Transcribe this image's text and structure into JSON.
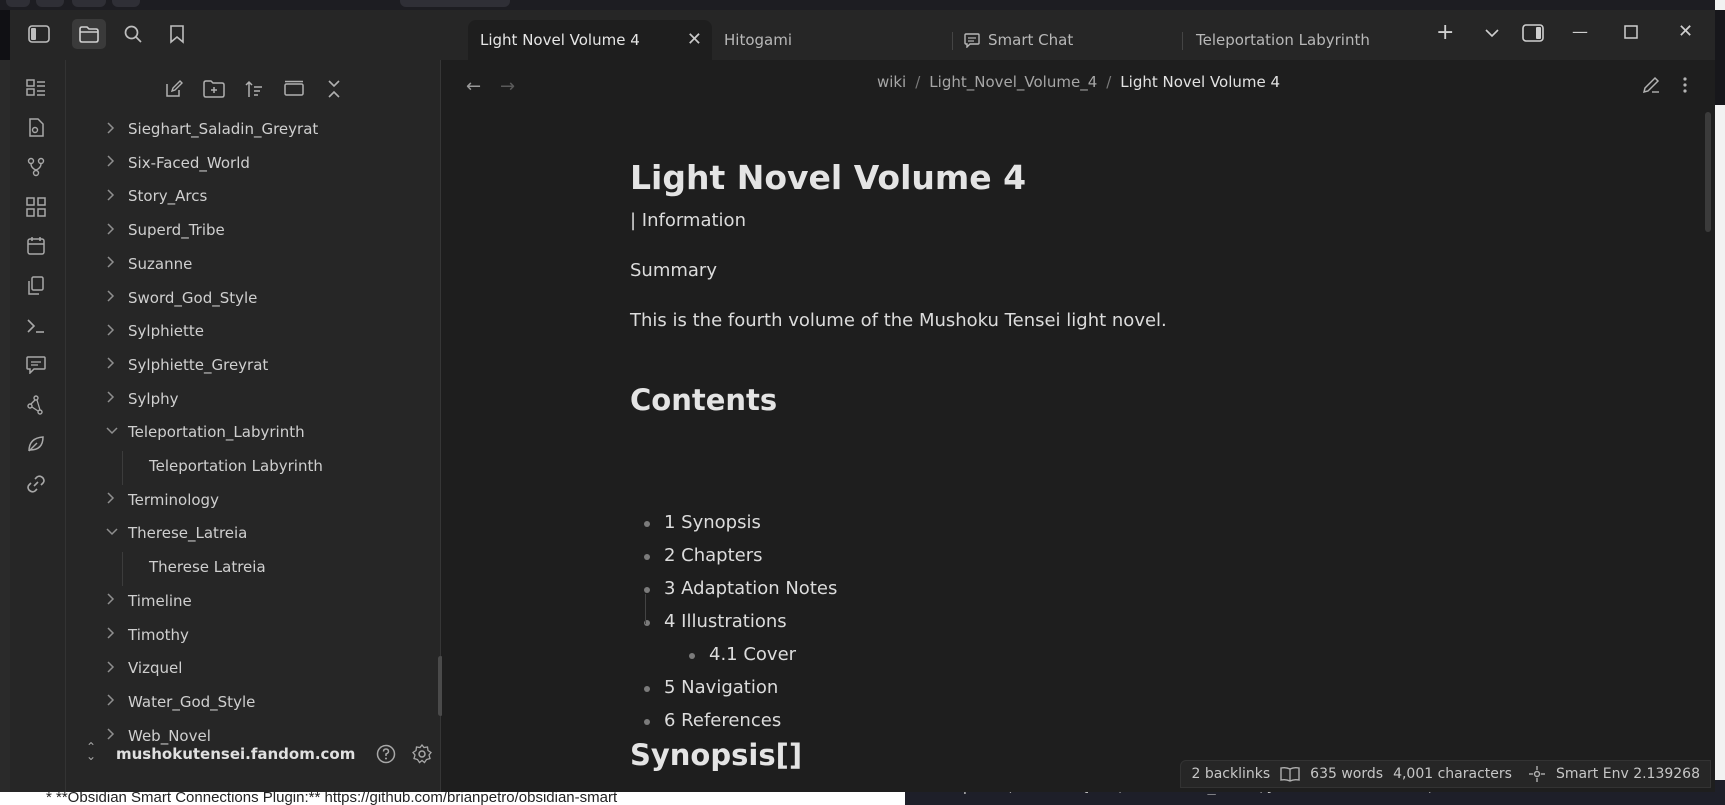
{
  "tabs": [
    {
      "label": "Light Novel Volume 4",
      "active": true
    },
    {
      "label": "Hitogami",
      "active": false
    },
    {
      "label": "Smart Chat",
      "active": false
    },
    {
      "label": "Teleportation Labyrinth",
      "active": false
    }
  ],
  "breadcrumb": {
    "root": "wiki",
    "folder": "Light_Novel_Volume_4",
    "current": "Light Novel Volume 4"
  },
  "file_tree": [
    {
      "label": "Sieghart_Saladin_Greyrat",
      "type": "folder",
      "expanded": false
    },
    {
      "label": "Six-Faced_World",
      "type": "folder",
      "expanded": false
    },
    {
      "label": "Story_Arcs",
      "type": "folder",
      "expanded": false
    },
    {
      "label": "Superd_Tribe",
      "type": "folder",
      "expanded": false
    },
    {
      "label": "Suzanne",
      "type": "folder",
      "expanded": false
    },
    {
      "label": "Sword_God_Style",
      "type": "folder",
      "expanded": false
    },
    {
      "label": "Sylphiette",
      "type": "folder",
      "expanded": false
    },
    {
      "label": "Sylphiette_Greyrat",
      "type": "folder",
      "expanded": false
    },
    {
      "label": "Sylphy",
      "type": "folder",
      "expanded": false
    },
    {
      "label": "Teleportation_Labyrinth",
      "type": "folder",
      "expanded": true
    },
    {
      "label": "Teleportation Labyrinth",
      "type": "file"
    },
    {
      "label": "Terminology",
      "type": "folder",
      "expanded": false
    },
    {
      "label": "Therese_Latreia",
      "type": "folder",
      "expanded": true
    },
    {
      "label": "Therese Latreia",
      "type": "file"
    },
    {
      "label": "Timeline",
      "type": "folder",
      "expanded": false
    },
    {
      "label": "Timothy",
      "type": "folder",
      "expanded": false
    },
    {
      "label": "Vizquel",
      "type": "folder",
      "expanded": false
    },
    {
      "label": "Water_God_Style",
      "type": "folder",
      "expanded": false
    },
    {
      "label": "Web_Novel",
      "type": "folder",
      "expanded": false
    }
  ],
  "vault": {
    "name": "mushokutensei.fandom.com"
  },
  "document": {
    "title": "Light Novel Volume 4",
    "info_line": "| Information",
    "summary_label": "Summary",
    "summary_text": "This is the fourth volume of the Mushoku Tensei light novel.",
    "contents_heading": "Contents",
    "toc": [
      {
        "label": "1 Synopsis",
        "level": 1
      },
      {
        "label": "2 Chapters",
        "level": 1
      },
      {
        "label": "3 Adaptation Notes",
        "level": 1
      },
      {
        "label": "4 Illustrations",
        "level": 1
      },
      {
        "label": "4.1 Cover",
        "level": 2
      },
      {
        "label": "5 Navigation",
        "level": 1
      },
      {
        "label": "6 References",
        "level": 1
      }
    ],
    "synopsis_heading": "Synopsis[]"
  },
  "status": {
    "backlinks": "2 backlinks",
    "words": "635 words",
    "characters": "4,001 characters",
    "smart_env": "Smart Env 2.139268"
  },
  "background": {
    "bottom_left_text": "* **Obsidian Smart Connections Plugin:** https://github.com/brianpetro/obsidian-smart",
    "bottom_right_code": "print(f\"Found {len(standalone_files)} standalone files\")"
  }
}
